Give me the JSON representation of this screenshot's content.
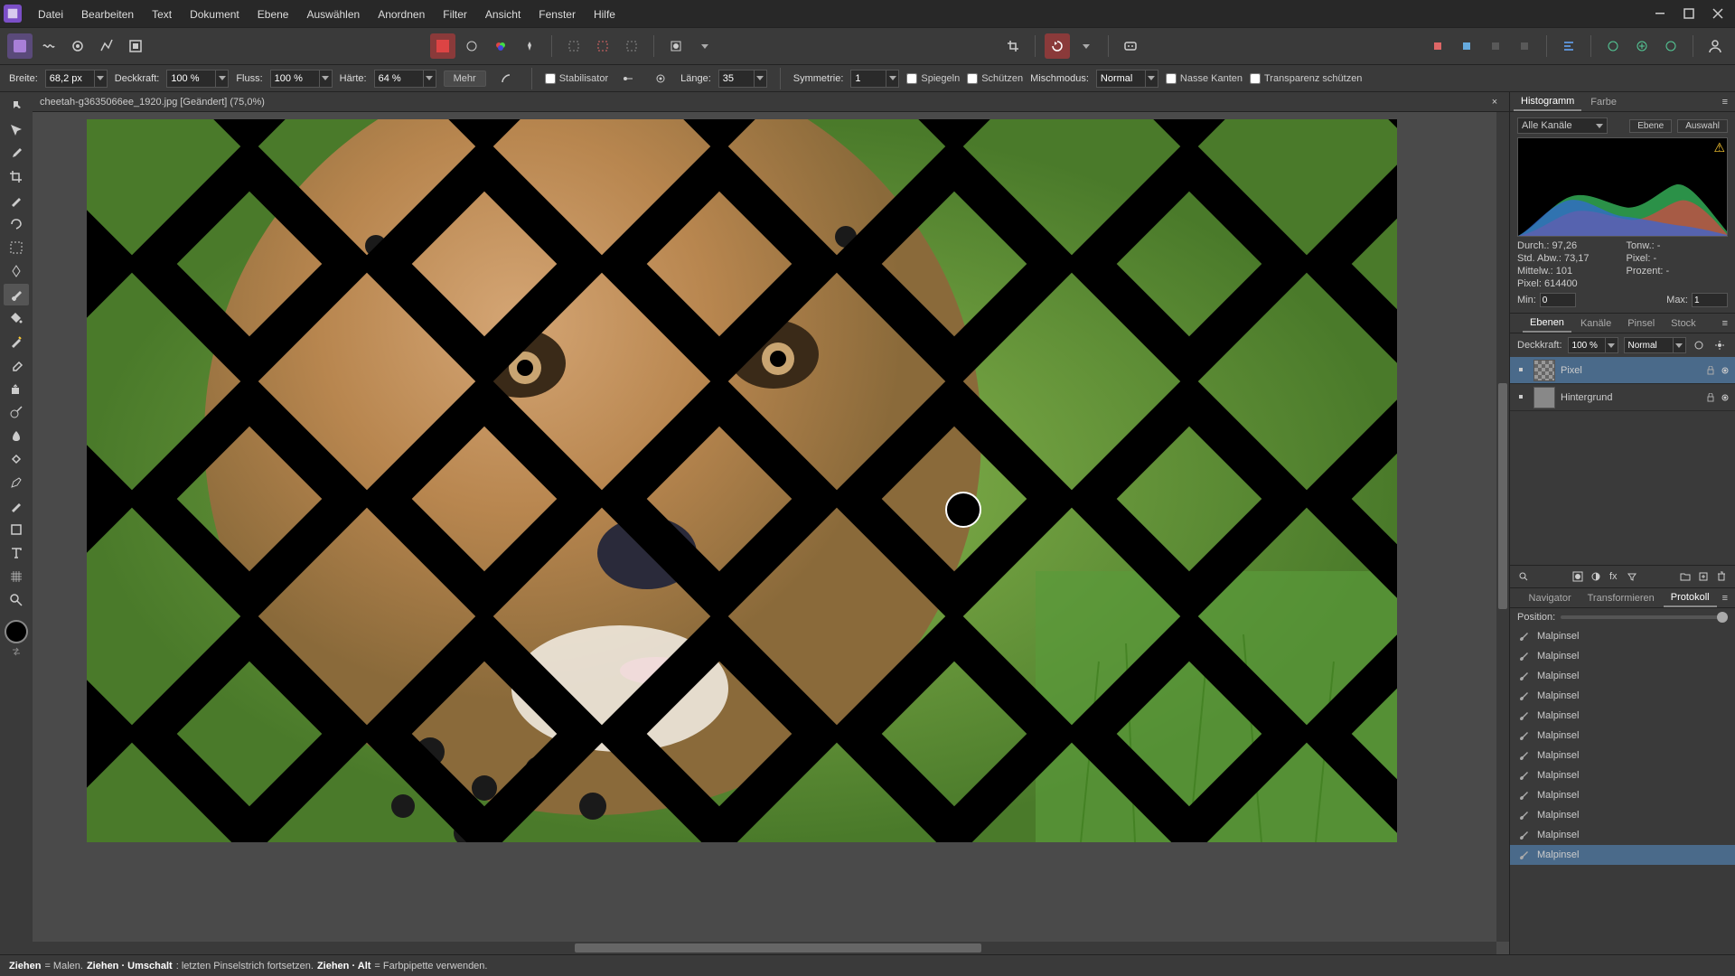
{
  "menu": [
    "Datei",
    "Bearbeiten",
    "Text",
    "Dokument",
    "Ebene",
    "Auswählen",
    "Anordnen",
    "Filter",
    "Ansicht",
    "Fenster",
    "Hilfe"
  ],
  "context": {
    "breite_label": "Breite:",
    "breite": "68,2 px",
    "deckkraft_label": "Deckkraft:",
    "deckkraft": "100 %",
    "fluss_label": "Fluss:",
    "fluss": "100 %",
    "haerte_label": "Härte:",
    "haerte": "64 %",
    "mehr": "Mehr",
    "stabilisator": "Stabilisator",
    "laenge_label": "Länge:",
    "laenge": "35",
    "symmetrie_label": "Symmetrie:",
    "symmetrie": "1",
    "spiegeln": "Spiegeln",
    "schuetzen": "Schützen",
    "mischmodus_label": "Mischmodus:",
    "mischmodus": "Normal",
    "nasse": "Nasse Kanten",
    "transparenz": "Transparenz schützen"
  },
  "doc_tab": "cheetah-g3635066ee_1920.jpg [Geändert] (75,0%)",
  "histogram": {
    "tab1": "Histogramm",
    "tab2": "Farbe",
    "channel": "Alle Kanäle",
    "ebene": "Ebene",
    "auswahl": "Auswahl",
    "durch_label": "Durch.:",
    "durch": "97,26",
    "stdabw_label": "Std. Abw.:",
    "stdabw": "73,17",
    "mittelw_label": "Mittelw.:",
    "mittelw": "101",
    "pixel_label": "Pixel:",
    "pixel": "614400",
    "tonw_label": "Tonw.:",
    "tonw": "-",
    "pixel2_label": "Pixel:",
    "pixel2": "-",
    "prozent_label": "Prozent:",
    "prozent": "-",
    "min_label": "Min:",
    "min": "0",
    "max_label": "Max:",
    "max": "1"
  },
  "layers": {
    "tabs": [
      "Ebenen",
      "Kanäle",
      "Pinsel",
      "Stock"
    ],
    "deckkraft_label": "Deckkraft:",
    "deckkraft": "100 %",
    "blend": "Normal",
    "items": [
      {
        "name": "Pixel",
        "selected": true,
        "checker": true
      },
      {
        "name": "Hintergrund",
        "selected": false,
        "checker": false
      }
    ]
  },
  "bottom": {
    "tabs": [
      "Navigator",
      "Transformieren",
      "Protokoll"
    ],
    "position_label": "Position:",
    "history": [
      "Malpinsel",
      "Malpinsel",
      "Malpinsel",
      "Malpinsel",
      "Malpinsel",
      "Malpinsel",
      "Malpinsel",
      "Malpinsel",
      "Malpinsel",
      "Malpinsel",
      "Malpinsel",
      "Malpinsel"
    ]
  },
  "status": {
    "s1a": "Ziehen",
    "s1b": " = Malen. ",
    "s2a": "Ziehen · Umschalt",
    "s2b": " : letzten Pinselstrich fortsetzen. ",
    "s3a": "Ziehen · Alt",
    "s3b": " = Farbpipette verwenden."
  }
}
